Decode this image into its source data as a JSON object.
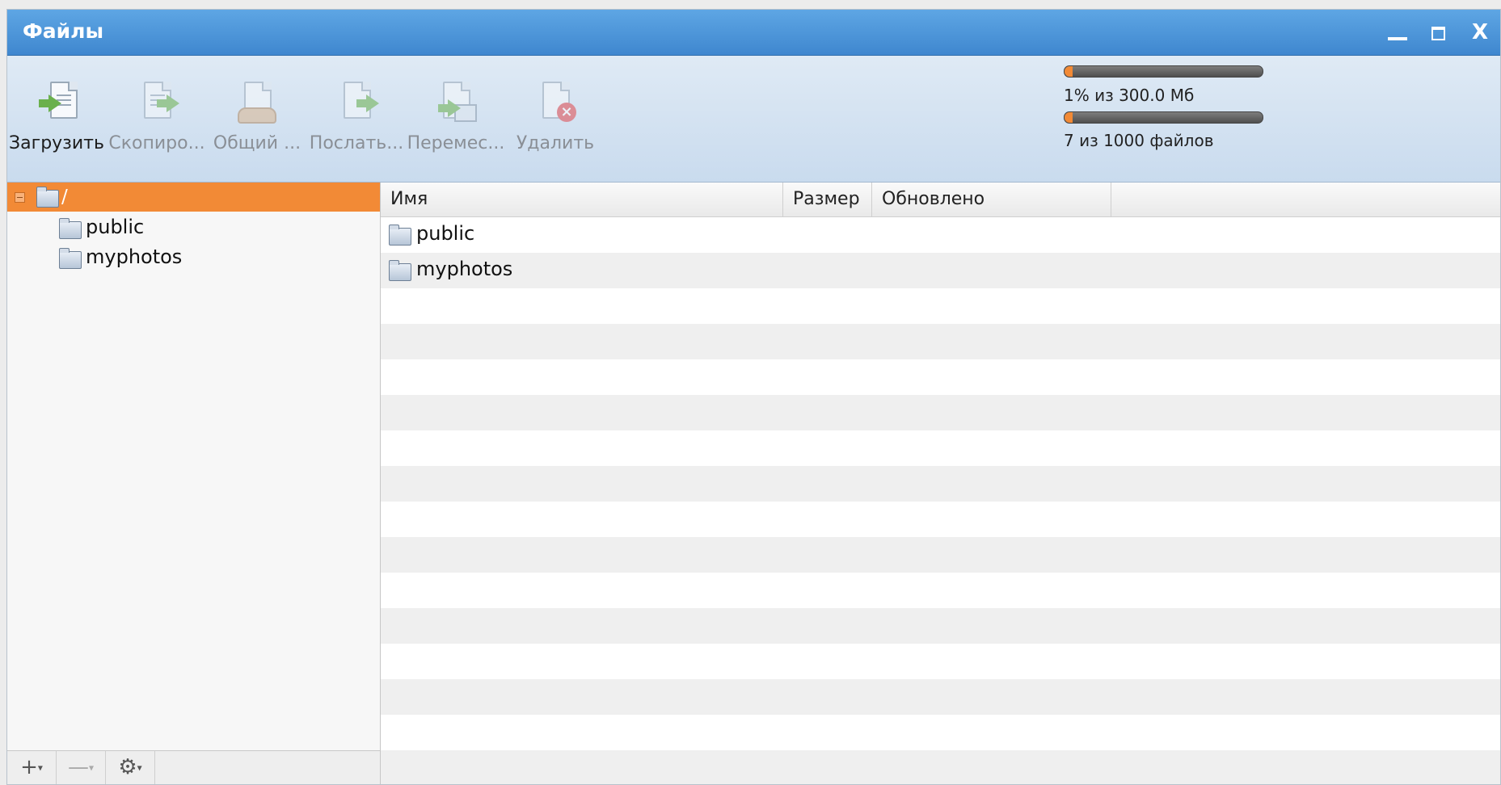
{
  "window": {
    "title": "Файлы",
    "controls": {
      "close": "X"
    }
  },
  "toolbar": {
    "buttons": [
      {
        "label": "Загрузить",
        "icon": "upload-icon",
        "enabled": true
      },
      {
        "label": "Скопиро...",
        "icon": "copy-icon",
        "enabled": false
      },
      {
        "label": "Общий ...",
        "icon": "share-icon",
        "enabled": false
      },
      {
        "label": "Послать...",
        "icon": "send-icon",
        "enabled": false
      },
      {
        "label": "Перемес...",
        "icon": "move-icon",
        "enabled": false
      },
      {
        "label": "Удалить",
        "icon": "delete-icon",
        "enabled": false
      }
    ],
    "quota": {
      "storage_text": "1% из 300.0 Мб",
      "storage_fraction": 0.01,
      "files_text": "7 из 1000 файлов",
      "files_fraction": 0.007,
      "accent": "#f28a36"
    }
  },
  "tree": {
    "root": {
      "label": "/"
    },
    "items": [
      {
        "label": "public"
      },
      {
        "label": "myphotos"
      }
    ],
    "bottom_buttons": [
      {
        "icon": "add-icon",
        "glyph": "+"
      },
      {
        "icon": "remove-icon",
        "glyph": "—"
      },
      {
        "icon": "gear-icon",
        "glyph": "⚙"
      }
    ]
  },
  "grid": {
    "columns": [
      "Имя",
      "Размер",
      "Обновлено"
    ],
    "rows": [
      {
        "name": "public",
        "size": "",
        "updated": ""
      },
      {
        "name": "myphotos",
        "size": "",
        "updated": ""
      }
    ]
  },
  "colors": {
    "titlebar": "#3f87cf",
    "selection": "#f28a36"
  }
}
